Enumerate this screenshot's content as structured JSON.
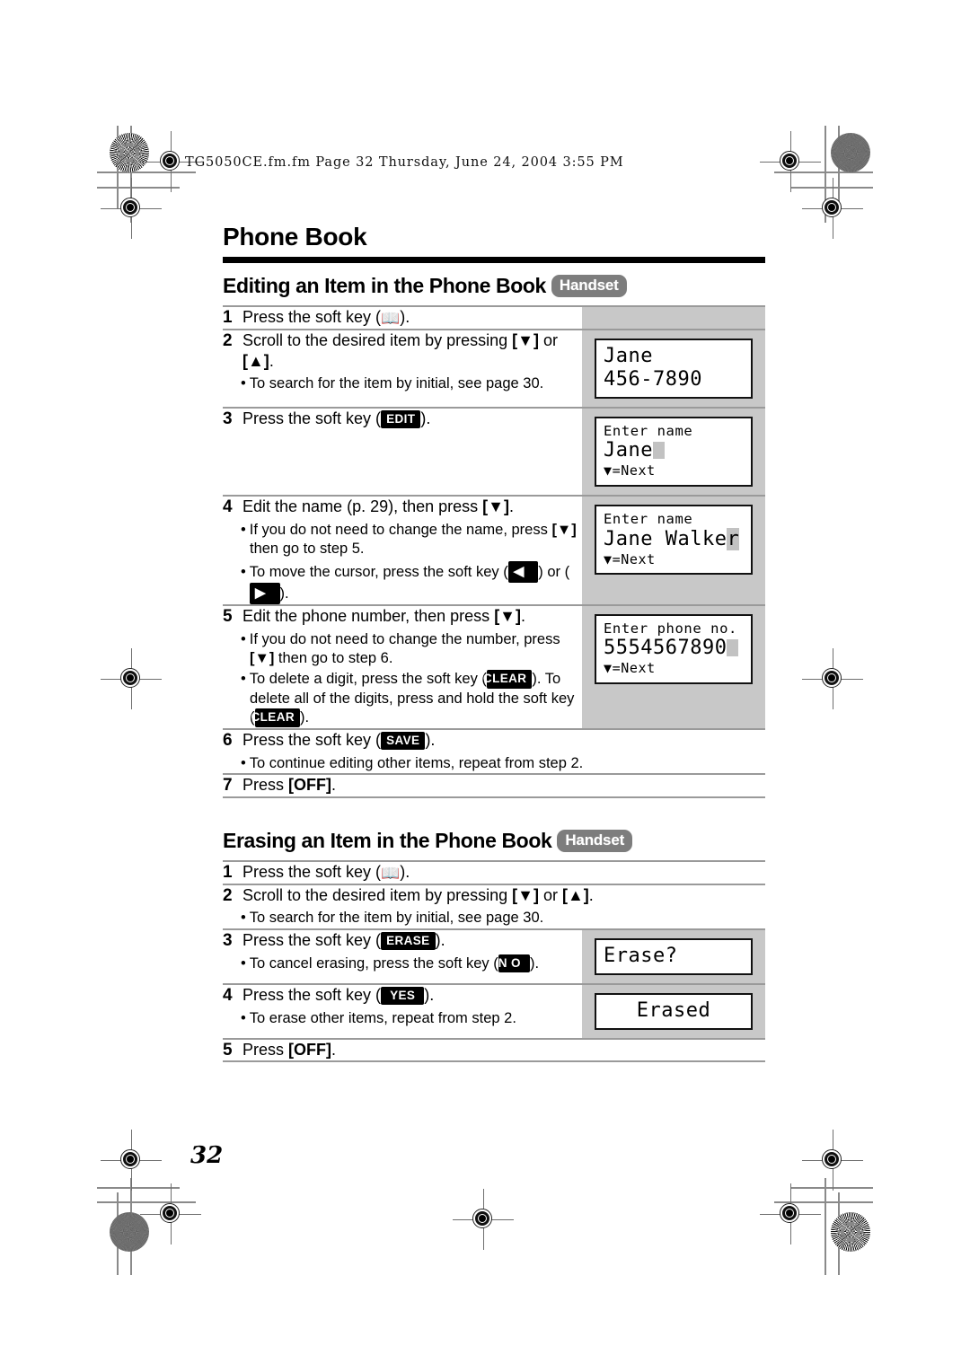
{
  "print_marks": {
    "file_stamp": "TG5050CE.fm.fm  Page 32  Thursday, June 24, 2004  3:55 PM",
    "page_number": "32"
  },
  "chapter": {
    "title": "Phone Book"
  },
  "sections": [
    {
      "id": "editing",
      "title": "Editing an Item in the Phone Book",
      "badge": "Handset",
      "steps": [
        {
          "num": "1",
          "text_parts": {
            "pre": "Press the soft key (",
            "icon": "phonebook-icon",
            "post": ")."
          },
          "bullets": []
        },
        {
          "num": "2",
          "text": "Scroll to the desired item by pressing [▼] or [▲].",
          "bullets": [
            "To search for the item by initial, see page 30."
          ]
        },
        {
          "num": "3",
          "text_parts": {
            "pre": "Press the soft key (",
            "chip": "EDIT",
            "post": ")."
          },
          "bullets": []
        },
        {
          "num": "4",
          "text": "Edit the name (p. 29), then press [▼].",
          "bullets": [
            "If you do not need to change the name, press [▼] then go to step 5.",
            "To move the cursor, press the soft key (◀) or (▶)."
          ]
        },
        {
          "num": "5",
          "text": "Edit the phone number, then press [▼].",
          "bullets": [
            "If you do not need to change the number, press [▼] then go to step 6.",
            "To delete a digit, press the soft key (CLEAR). To delete all of the digits, press and hold the soft key (CLEAR)."
          ]
        },
        {
          "num": "6",
          "text_parts": {
            "pre": "Press the soft key (",
            "chip": "SAVE",
            "post": ")."
          },
          "bullets": [
            "To continue editing other items, repeat from step 2."
          ]
        },
        {
          "num": "7",
          "text_parts": {
            "pre": "Press ",
            "kb": "[OFF]",
            "post": "."
          },
          "bullets": []
        }
      ],
      "displays": [
        {
          "for_step": "2",
          "lines": [
            {
              "style": "big",
              "text": "Jane"
            },
            {
              "style": "big",
              "text": "456-7890"
            }
          ]
        },
        {
          "for_step": "3",
          "lines": [
            {
              "style": "small",
              "text": "Enter name"
            },
            {
              "style": "big-cursor",
              "text": "Jane"
            },
            {
              "style": "next",
              "text": "▼=Next"
            }
          ]
        },
        {
          "for_step": "4",
          "lines": [
            {
              "style": "small",
              "text": "Enter name"
            },
            {
              "style": "big-lastcursor",
              "text": "Jane Walker"
            },
            {
              "style": "next",
              "text": "▼=Next"
            }
          ]
        },
        {
          "for_step": "5",
          "lines": [
            {
              "style": "small",
              "text": "Enter phone no."
            },
            {
              "style": "big-cursor",
              "text": "5554567890"
            },
            {
              "style": "next",
              "text": "▼=Next"
            }
          ]
        }
      ]
    },
    {
      "id": "erasing",
      "title": "Erasing an Item in the Phone Book",
      "badge": "Handset",
      "steps": [
        {
          "num": "1",
          "text_parts": {
            "pre": "Press the soft key (",
            "icon": "phonebook-icon",
            "post": ")."
          },
          "bullets": []
        },
        {
          "num": "2",
          "text": "Scroll to the desired item by pressing [▼] or [▲].",
          "bullets": [
            "To search for the item by initial, see page 30."
          ]
        },
        {
          "num": "3",
          "text_parts": {
            "pre": "Press the soft key (",
            "chip": "ERASE",
            "post": ")."
          },
          "bullets": [
            "To cancel erasing, press the soft key (NO)."
          ]
        },
        {
          "num": "4",
          "text_parts": {
            "pre": "Press the soft key (",
            "chip": "YES",
            "post": ")."
          },
          "bullets": [
            "To erase other items, repeat from step 2."
          ]
        },
        {
          "num": "5",
          "text_parts": {
            "pre": "Press ",
            "kb": "[OFF]",
            "post": "."
          },
          "bullets": []
        }
      ],
      "displays": [
        {
          "for_step": "3",
          "lines": [
            {
              "style": "big",
              "text": "Erase?"
            }
          ]
        },
        {
          "for_step": "4",
          "lines": [
            {
              "style": "big-center",
              "text": "Erased"
            }
          ]
        }
      ]
    }
  ],
  "softkeys": {
    "edit": "EDIT",
    "clear": "CLEAR",
    "save": "SAVE",
    "erase": "ERASE",
    "yes": "YES",
    "no": "N O",
    "left_arrow": "◀",
    "right_arrow": "▶"
  },
  "keys": {
    "off": "[OFF]",
    "down": "[▼]",
    "up": "[▲]"
  },
  "colors": {
    "badge_gray": "#7d7d7d",
    "panel_gray": "#c8c8c8",
    "rule_gray": "#9a9a9a",
    "chip_black": "#000000",
    "cursor_gray": "#c2c2c2"
  }
}
